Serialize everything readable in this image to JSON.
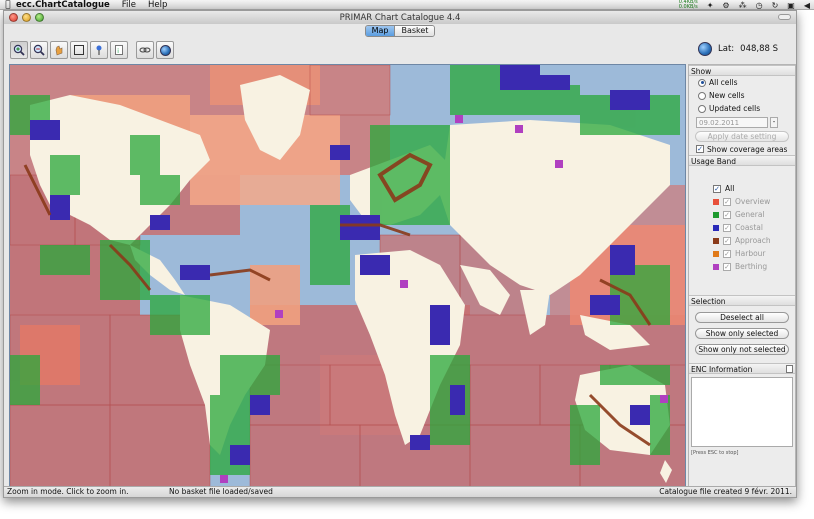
{
  "menubar": {
    "app_name": "ecc.ChartCatalogue",
    "items": [
      "File",
      "Help"
    ],
    "rates": [
      "0.4KB/s",
      "0.0KB/s"
    ]
  },
  "window": {
    "title": "PRIMAR Chart Catalogue 4.4"
  },
  "tabs": [
    {
      "label": "Map",
      "active": true
    },
    {
      "label": "Basket",
      "active": false
    }
  ],
  "toolbar": {
    "lat_label": "Lat:",
    "lat_value": "048,88 S"
  },
  "panel": {
    "show": {
      "header": "Show",
      "options": [
        {
          "label": "All cells",
          "selected": true
        },
        {
          "label": "New cells",
          "selected": false
        },
        {
          "label": "Updated cells",
          "selected": false
        }
      ],
      "date_value": "09.02.2011",
      "stepper": "-",
      "apply_label": "Apply date setting",
      "coverage_label": "Show coverage areas",
      "coverage_checked": true
    },
    "usage": {
      "header": "Usage Band",
      "all_label": "All",
      "bands": [
        {
          "label": "Overview",
          "color": "#e8503a"
        },
        {
          "label": "General",
          "color": "#1e9a2e"
        },
        {
          "label": "Coastal",
          "color": "#2a2ab8"
        },
        {
          "label": "Approach",
          "color": "#8a3a1a"
        },
        {
          "label": "Harbour",
          "color": "#e07a1a"
        },
        {
          "label": "Berthing",
          "color": "#b040c0"
        }
      ]
    },
    "selection": {
      "header": "Selection",
      "buttons": [
        "Deselect all",
        "Show only selected",
        "Show only not selected"
      ]
    },
    "enc": {
      "header": "ENC Information",
      "note": "[Press ESC to stop]"
    }
  },
  "status": {
    "left": "Zoom in mode. Click to zoom in.",
    "middle": "No basket file loaded/saved",
    "right": "Catalogue file created 9 févr. 2011."
  },
  "colors": {
    "sea": "#9dbad9",
    "land": "#f8f2e2",
    "overview": "#e06a55",
    "overview_dark": "#c86868",
    "general": "#2aa83a",
    "coastal": "#3a2ab0"
  }
}
